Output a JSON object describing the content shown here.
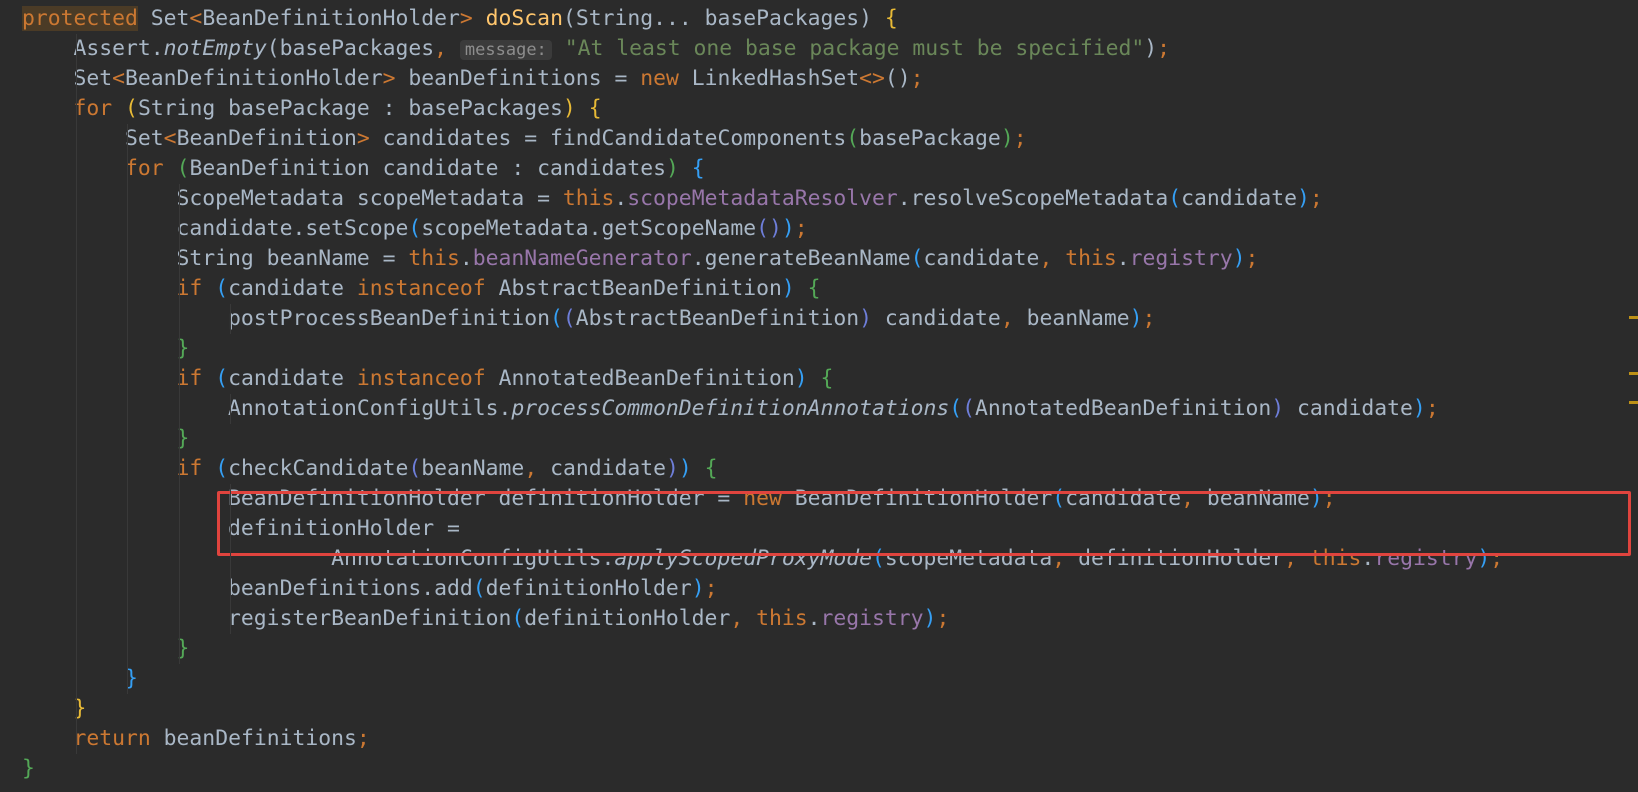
{
  "editor": {
    "theme_colors": {
      "background": "#2b2b2b",
      "keyword": "#cc7832",
      "text": "#a9b7c6",
      "method": "#ffc66d",
      "field": "#9876aa",
      "string": "#6a8759",
      "highlight_box": "#e0443e"
    },
    "lines": [
      [
        {
          "t": "protected",
          "c": "kw-hl"
        },
        {
          "t": " Set",
          "c": "tx"
        },
        {
          "t": "<",
          "c": "kw"
        },
        {
          "t": "BeanDefinitionHolder",
          "c": "tx"
        },
        {
          "t": ">",
          "c": "kw"
        },
        {
          "t": " ",
          "c": "tx"
        },
        {
          "t": "doScan",
          "c": "fn"
        },
        {
          "t": "(String... basePackages) ",
          "c": "tx"
        },
        {
          "t": "{",
          "c": "p1"
        }
      ],
      [
        {
          "t": "    Assert.",
          "c": "tx"
        },
        {
          "t": "notEmpty",
          "c": "it"
        },
        {
          "t": "(basePackages",
          "c": "tx"
        },
        {
          "t": ",",
          "c": "kw"
        },
        {
          "t": " ",
          "c": "tx"
        },
        {
          "t": "message:",
          "c": "hn"
        },
        {
          "t": " ",
          "c": "tx"
        },
        {
          "t": "\"At least one base package must be specified\"",
          "c": "st"
        },
        {
          "t": ")",
          "c": "tx"
        },
        {
          "t": ";",
          "c": "kw"
        }
      ],
      [
        {
          "t": "    Set",
          "c": "tx"
        },
        {
          "t": "<",
          "c": "kw"
        },
        {
          "t": "BeanDefinitionHolder",
          "c": "tx"
        },
        {
          "t": ">",
          "c": "kw"
        },
        {
          "t": " beanDefinitions = ",
          "c": "tx"
        },
        {
          "t": "new",
          "c": "kw"
        },
        {
          "t": " LinkedHashSet",
          "c": "tx"
        },
        {
          "t": "<>",
          "c": "kw"
        },
        {
          "t": "()",
          "c": "tx"
        },
        {
          "t": ";",
          "c": "kw"
        }
      ],
      [
        {
          "t": "    ",
          "c": "tx"
        },
        {
          "t": "for",
          "c": "kw"
        },
        {
          "t": " ",
          "c": "tx"
        },
        {
          "t": "(",
          "c": "p1"
        },
        {
          "t": "String basePackage : basePackages",
          "c": "tx"
        },
        {
          "t": ")",
          "c": "p1"
        },
        {
          "t": " ",
          "c": "tx"
        },
        {
          "t": "{",
          "c": "p1"
        }
      ],
      [
        {
          "t": "        Set",
          "c": "tx"
        },
        {
          "t": "<",
          "c": "kw"
        },
        {
          "t": "BeanDefinition",
          "c": "tx"
        },
        {
          "t": ">",
          "c": "kw"
        },
        {
          "t": " candidates = findCandidateComponents",
          "c": "tx"
        },
        {
          "t": "(",
          "c": "p2"
        },
        {
          "t": "basePackage",
          "c": "tx"
        },
        {
          "t": ")",
          "c": "p2"
        },
        {
          "t": ";",
          "c": "kw"
        }
      ],
      [
        {
          "t": "        ",
          "c": "tx"
        },
        {
          "t": "for",
          "c": "kw"
        },
        {
          "t": " ",
          "c": "tx"
        },
        {
          "t": "(",
          "c": "p2"
        },
        {
          "t": "BeanDefinition candidate : candidates",
          "c": "tx"
        },
        {
          "t": ")",
          "c": "p2"
        },
        {
          "t": " ",
          "c": "tx"
        },
        {
          "t": "{",
          "c": "p3"
        }
      ],
      [
        {
          "t": "            ScopeMetadata scopeMetadata = ",
          "c": "tx"
        },
        {
          "t": "this",
          "c": "kw"
        },
        {
          "t": ".",
          "c": "tx"
        },
        {
          "t": "scopeMetadataResolver",
          "c": "fd"
        },
        {
          "t": ".resolveScopeMetadata",
          "c": "tx"
        },
        {
          "t": "(",
          "c": "p3"
        },
        {
          "t": "candidate",
          "c": "tx"
        },
        {
          "t": ")",
          "c": "p3"
        },
        {
          "t": ";",
          "c": "kw"
        }
      ],
      [
        {
          "t": "            candidate.setScope",
          "c": "tx"
        },
        {
          "t": "(",
          "c": "p3"
        },
        {
          "t": "scopeMetadata.getScopeName",
          "c": "tx"
        },
        {
          "t": "()",
          "c": "p4"
        },
        {
          "t": ")",
          "c": "p3"
        },
        {
          "t": ";",
          "c": "kw"
        }
      ],
      [
        {
          "t": "            String beanName = ",
          "c": "tx"
        },
        {
          "t": "this",
          "c": "kw"
        },
        {
          "t": ".",
          "c": "tx"
        },
        {
          "t": "beanNameGenerator",
          "c": "fd"
        },
        {
          "t": ".generateBeanName",
          "c": "tx"
        },
        {
          "t": "(",
          "c": "p3"
        },
        {
          "t": "candidate",
          "c": "tx"
        },
        {
          "t": ",",
          "c": "kw"
        },
        {
          "t": " ",
          "c": "tx"
        },
        {
          "t": "this",
          "c": "kw"
        },
        {
          "t": ".",
          "c": "tx"
        },
        {
          "t": "registry",
          "c": "fd"
        },
        {
          "t": ")",
          "c": "p3"
        },
        {
          "t": ";",
          "c": "kw"
        }
      ],
      [
        {
          "t": "            ",
          "c": "tx"
        },
        {
          "t": "if",
          "c": "kw"
        },
        {
          "t": " ",
          "c": "tx"
        },
        {
          "t": "(",
          "c": "p3"
        },
        {
          "t": "candidate ",
          "c": "tx"
        },
        {
          "t": "instanceof",
          "c": "kw"
        },
        {
          "t": " AbstractBeanDefinition",
          "c": "tx"
        },
        {
          "t": ")",
          "c": "p3"
        },
        {
          "t": " ",
          "c": "tx"
        },
        {
          "t": "{",
          "c": "p2"
        }
      ],
      [
        {
          "t": "                postProcessBeanDefinition",
          "c": "tx"
        },
        {
          "t": "(",
          "c": "p3"
        },
        {
          "t": "(",
          "c": "p4"
        },
        {
          "t": "AbstractBeanDefinition",
          "c": "tx"
        },
        {
          "t": ")",
          "c": "p4"
        },
        {
          "t": " candidate",
          "c": "tx"
        },
        {
          "t": ",",
          "c": "kw"
        },
        {
          "t": " beanName",
          "c": "tx"
        },
        {
          "t": ")",
          "c": "p3"
        },
        {
          "t": ";",
          "c": "kw"
        }
      ],
      [
        {
          "t": "            ",
          "c": "tx"
        },
        {
          "t": "}",
          "c": "p2"
        }
      ],
      [
        {
          "t": "            ",
          "c": "tx"
        },
        {
          "t": "if",
          "c": "kw"
        },
        {
          "t": " ",
          "c": "tx"
        },
        {
          "t": "(",
          "c": "p3"
        },
        {
          "t": "candidate ",
          "c": "tx"
        },
        {
          "t": "instanceof",
          "c": "kw"
        },
        {
          "t": " AnnotatedBeanDefinition",
          "c": "tx"
        },
        {
          "t": ")",
          "c": "p3"
        },
        {
          "t": " ",
          "c": "tx"
        },
        {
          "t": "{",
          "c": "p2"
        }
      ],
      [
        {
          "t": "                AnnotationConfigUtils.",
          "c": "tx"
        },
        {
          "t": "processCommonDefinitionAnnotations",
          "c": "it"
        },
        {
          "t": "(",
          "c": "p3"
        },
        {
          "t": "(",
          "c": "p4"
        },
        {
          "t": "AnnotatedBeanDefinition",
          "c": "tx"
        },
        {
          "t": ")",
          "c": "p4"
        },
        {
          "t": " candidate",
          "c": "tx"
        },
        {
          "t": ")",
          "c": "p3"
        },
        {
          "t": ";",
          "c": "kw"
        }
      ],
      [
        {
          "t": "            ",
          "c": "tx"
        },
        {
          "t": "}",
          "c": "p2"
        }
      ],
      [
        {
          "t": "            ",
          "c": "tx"
        },
        {
          "t": "if",
          "c": "kw"
        },
        {
          "t": " ",
          "c": "tx"
        },
        {
          "t": "(",
          "c": "p3"
        },
        {
          "t": "checkCandidate",
          "c": "tx"
        },
        {
          "t": "(",
          "c": "p4"
        },
        {
          "t": "beanName",
          "c": "tx"
        },
        {
          "t": ",",
          "c": "kw"
        },
        {
          "t": " candidate",
          "c": "tx"
        },
        {
          "t": ")",
          "c": "p4"
        },
        {
          "t": ")",
          "c": "p3"
        },
        {
          "t": " ",
          "c": "tx"
        },
        {
          "t": "{",
          "c": "p2"
        }
      ],
      [
        {
          "t": "                BeanDefinitionHolder definitionHolder = ",
          "c": "tx"
        },
        {
          "t": "new",
          "c": "kw"
        },
        {
          "t": " BeanDefinitionHolder",
          "c": "tx"
        },
        {
          "t": "(",
          "c": "p3"
        },
        {
          "t": "candidate",
          "c": "tx"
        },
        {
          "t": ",",
          "c": "kw"
        },
        {
          "t": " beanName",
          "c": "tx"
        },
        {
          "t": ")",
          "c": "p3"
        },
        {
          "t": ";",
          "c": "kw"
        }
      ],
      [
        {
          "t": "                definitionHolder =",
          "c": "tx"
        }
      ],
      [
        {
          "t": "                        AnnotationConfigUtils.",
          "c": "tx"
        },
        {
          "t": "applyScopedProxyMode",
          "c": "it"
        },
        {
          "t": "(",
          "c": "p3"
        },
        {
          "t": "scopeMetadata",
          "c": "tx"
        },
        {
          "t": ",",
          "c": "kw"
        },
        {
          "t": " definitionHolder",
          "c": "tx"
        },
        {
          "t": ",",
          "c": "kw"
        },
        {
          "t": " ",
          "c": "tx"
        },
        {
          "t": "this",
          "c": "kw"
        },
        {
          "t": ".",
          "c": "tx"
        },
        {
          "t": "registry",
          "c": "fd"
        },
        {
          "t": ")",
          "c": "p3"
        },
        {
          "t": ";",
          "c": "kw"
        }
      ],
      [
        {
          "t": "                beanDefinitions.add",
          "c": "tx"
        },
        {
          "t": "(",
          "c": "p3"
        },
        {
          "t": "definitionHolder",
          "c": "tx"
        },
        {
          "t": ")",
          "c": "p3"
        },
        {
          "t": ";",
          "c": "kw"
        }
      ],
      [
        {
          "t": "                registerBeanDefinition",
          "c": "tx"
        },
        {
          "t": "(",
          "c": "p3"
        },
        {
          "t": "definitionHolder",
          "c": "tx"
        },
        {
          "t": ",",
          "c": "kw"
        },
        {
          "t": " ",
          "c": "tx"
        },
        {
          "t": "this",
          "c": "kw"
        },
        {
          "t": ".",
          "c": "tx"
        },
        {
          "t": "registry",
          "c": "fd"
        },
        {
          "t": ")",
          "c": "p3"
        },
        {
          "t": ";",
          "c": "kw"
        }
      ],
      [
        {
          "t": "            ",
          "c": "tx"
        },
        {
          "t": "}",
          "c": "p2"
        }
      ],
      [
        {
          "t": "        ",
          "c": "tx"
        },
        {
          "t": "}",
          "c": "p3"
        }
      ],
      [
        {
          "t": "    ",
          "c": "tx"
        },
        {
          "t": "}",
          "c": "p1"
        }
      ],
      [
        {
          "t": "    ",
          "c": "tx"
        },
        {
          "t": "return",
          "c": "kw"
        },
        {
          "t": " beanDefinitions",
          "c": "tx"
        },
        {
          "t": ";",
          "c": "kw"
        }
      ],
      [
        {
          "t": "}",
          "c": "p2"
        }
      ]
    ]
  }
}
